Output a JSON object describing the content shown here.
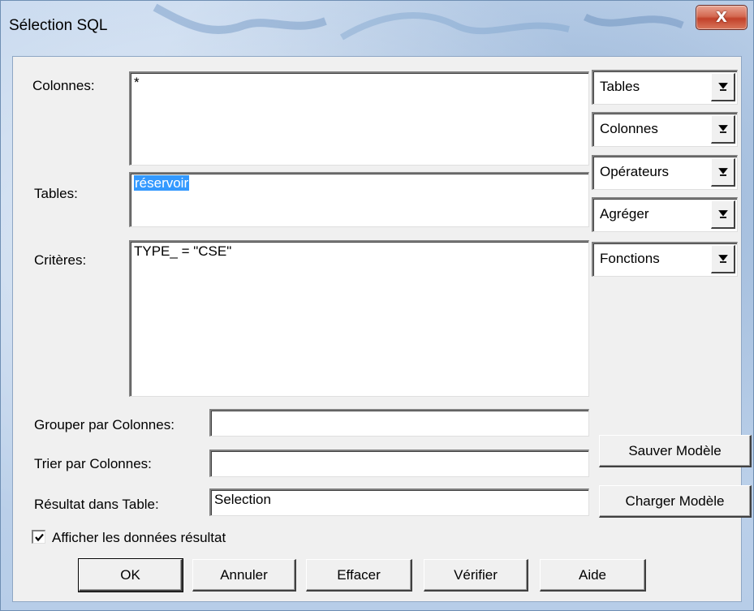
{
  "window": {
    "title": "Sélection SQL",
    "close_glyph": "X"
  },
  "form": {
    "columns": {
      "label": "Colonnes:",
      "value": "*"
    },
    "tables": {
      "label": "Tables:",
      "value": "réservoir"
    },
    "criteria": {
      "label": "Critères:",
      "value": "TYPE_ = \"CSE\""
    },
    "group_by": {
      "label": "Grouper par Colonnes:",
      "value": ""
    },
    "order_by": {
      "label": "Trier par Colonnes:",
      "value": ""
    },
    "result_table": {
      "label": "Résultat dans Table:",
      "value": "Selection"
    },
    "show_results": {
      "label": "Afficher les données résultat",
      "checked": true
    }
  },
  "dropdowns": [
    {
      "label": "Tables"
    },
    {
      "label": "Colonnes"
    },
    {
      "label": "Opérateurs"
    },
    {
      "label": "Agréger"
    },
    {
      "label": "Fonctions"
    }
  ],
  "side_buttons": {
    "save_template": "Sauver Modèle",
    "load_template": "Charger Modèle"
  },
  "buttons": {
    "ok": "OK",
    "cancel": "Annuler",
    "clear": "Effacer",
    "verify": "Vérifier",
    "help": "Aide"
  },
  "colors": {
    "selection": "#3399ff",
    "close_button": "#c2412a",
    "dialog_bg": "#f0f0f0"
  }
}
